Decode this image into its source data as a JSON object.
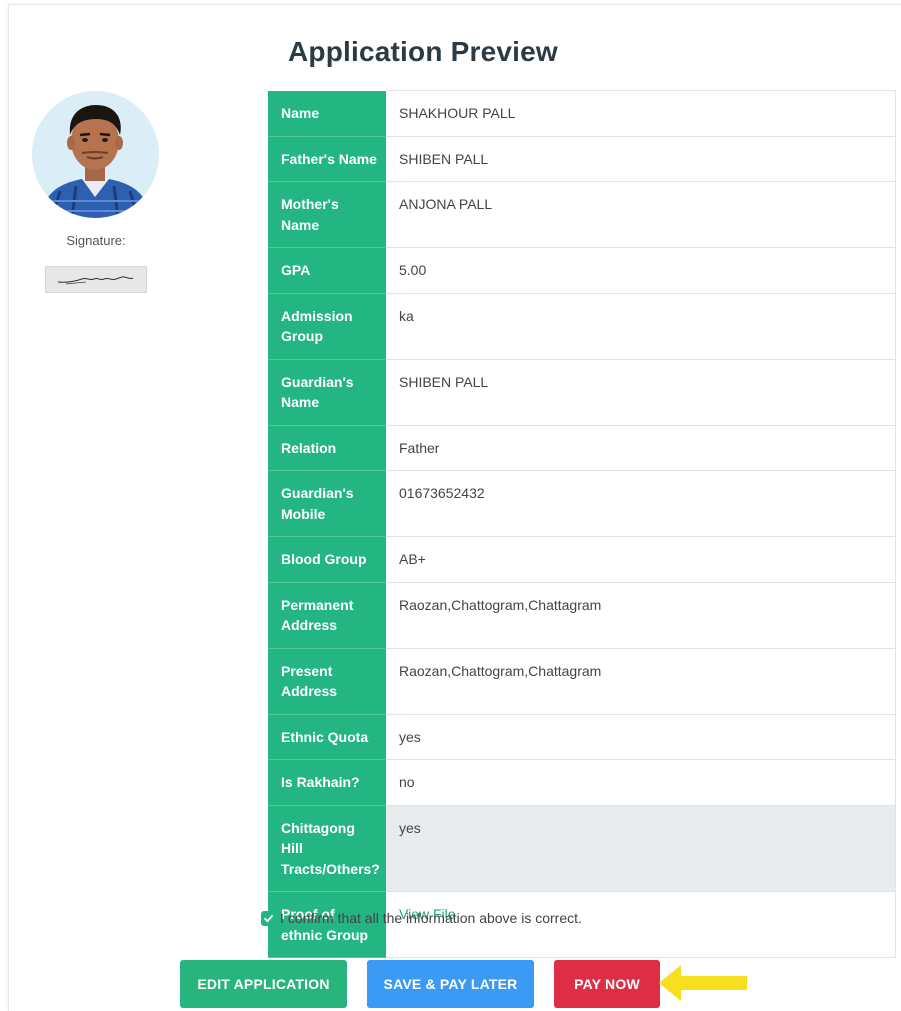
{
  "page": {
    "title": "Application Preview"
  },
  "sidebar": {
    "signature_label": "Signature:"
  },
  "fields": [
    {
      "label": "Name",
      "value": "SHAKHOUR PALL"
    },
    {
      "label": "Father's Name",
      "value": "SHIBEN PALL"
    },
    {
      "label": "Mother's Name",
      "value": "ANJONA PALL"
    },
    {
      "label": "GPA",
      "value": "5.00"
    },
    {
      "label": "Admission Group",
      "value": "ka"
    },
    {
      "label": "Guardian's Name",
      "value": "SHIBEN PALL"
    },
    {
      "label": "Relation",
      "value": "Father"
    },
    {
      "label": "Guardian's Mobile",
      "value": "01673652432"
    },
    {
      "label": "Blood Group",
      "value": "AB+"
    },
    {
      "label": "Permanent Address",
      "value": "Raozan,Chattogram,Chattagram"
    },
    {
      "label": "Present Address",
      "value": "Raozan,Chattogram,Chattagram"
    },
    {
      "label": "Ethnic Quota",
      "value": "yes"
    },
    {
      "label": "Is Rakhain?",
      "value": "no"
    },
    {
      "label": "Chittagong Hill Tracts/Others?",
      "value": "yes"
    },
    {
      "label": "Proof of ethnic Group",
      "value": "View File"
    }
  ],
  "confirm": {
    "checked": true,
    "text": "I confirm that all the information above is correct."
  },
  "actions": {
    "edit_label": "EDIT APPLICATION",
    "save_label": "SAVE & PAY LATER",
    "pay_label": "PAY NOW"
  },
  "colors": {
    "accent_green": "#24b682",
    "save_blue": "#3b9af3",
    "pay_red": "#dc2f45",
    "arrow_yellow": "#f7df1e",
    "highlight_row": "#e9ecef"
  },
  "icons": {
    "checkbox": "check-icon",
    "pointer": "arrow-left-icon"
  }
}
